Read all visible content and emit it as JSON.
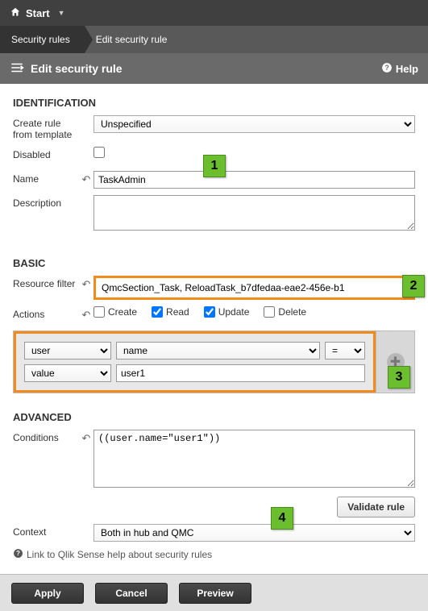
{
  "topbar": {
    "start": "Start"
  },
  "breadcrumb": {
    "rules": "Security rules",
    "edit": "Edit security rule"
  },
  "subheader": {
    "title": "Edit security rule",
    "help": "Help"
  },
  "identification": {
    "title": "IDENTIFICATION",
    "template_label": "Create rule from template",
    "template_value": "Unspecified",
    "disabled_label": "Disabled",
    "name_label": "Name",
    "name_value": "TaskAdmin",
    "desc_label": "Description",
    "desc_value": ""
  },
  "basic": {
    "title": "BASIC",
    "filter_label": "Resource filter",
    "filter_value": "QmcSection_Task, ReloadTask_b7dfedaa-eae2-456e-b1",
    "actions_label": "Actions",
    "actions": {
      "create": {
        "label": "Create",
        "checked": false
      },
      "read": {
        "label": "Read",
        "checked": true
      },
      "update": {
        "label": "Update",
        "checked": true
      },
      "delete": {
        "label": "Delete",
        "checked": false
      }
    },
    "cond": {
      "subject": "user",
      "attribute": "name",
      "operator": "=",
      "value_kind": "value",
      "value": "user1"
    }
  },
  "advanced": {
    "title": "ADVANCED",
    "cond_label": "Conditions",
    "cond_value": "((user.name=\"user1\"))",
    "validate": "Validate rule",
    "context_label": "Context",
    "context_value": "Both in hub and QMC",
    "hint": "Link to Qlik Sense help about security rules"
  },
  "footer": {
    "apply": "Apply",
    "cancel": "Cancel",
    "preview": "Preview"
  },
  "callouts": {
    "c1": "1",
    "c2": "2",
    "c3": "3",
    "c4": "4"
  }
}
